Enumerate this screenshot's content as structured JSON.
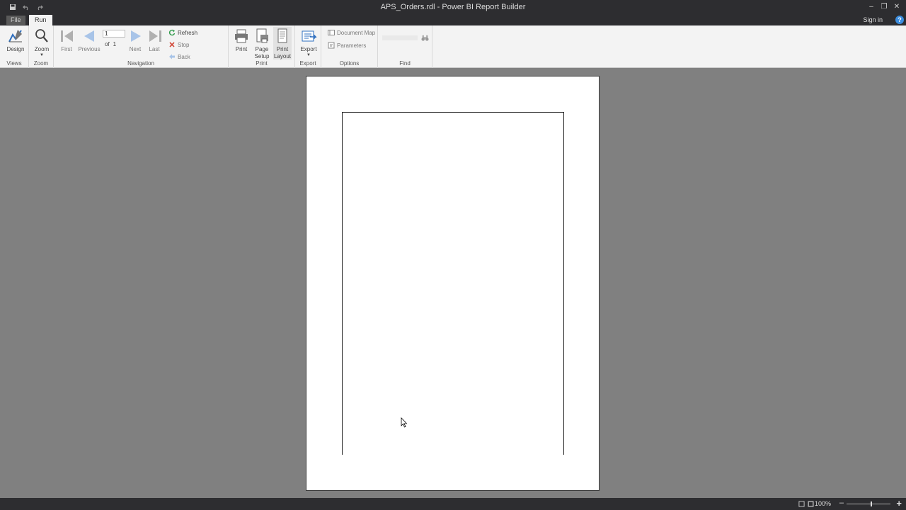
{
  "window": {
    "title": "APS_Orders.rdl - Power BI Report Builder"
  },
  "tabs": {
    "file": "File",
    "run": "Run",
    "signin": "Sign in",
    "help": "?"
  },
  "ribbon": {
    "views": {
      "design": "Design",
      "label": "Views"
    },
    "zoom": {
      "zoom": "Zoom",
      "label": "Zoom"
    },
    "navigation": {
      "first": "First",
      "previous": "Previous",
      "page_value": "1",
      "of": "of",
      "total_pages": "1",
      "next": "Next",
      "last": "Last",
      "refresh": "Refresh",
      "stop": "Stop",
      "back": "Back",
      "label": "Navigation"
    },
    "print": {
      "print": "Print",
      "page_setup_1": "Page",
      "page_setup_2": "Setup",
      "print_layout_1": "Print",
      "print_layout_2": "Layout",
      "label": "Print"
    },
    "export": {
      "export": "Export",
      "label": "Export"
    },
    "options": {
      "document_map": "Document Map",
      "parameters": "Parameters",
      "label": "Options"
    },
    "find": {
      "label": "Find"
    }
  },
  "status": {
    "zoom_level": "100%"
  },
  "colors": {
    "chrome": "#2d2d30",
    "ribbon": "#f3f3f3",
    "workspace": "#808080",
    "accent": "#3c8dde"
  }
}
